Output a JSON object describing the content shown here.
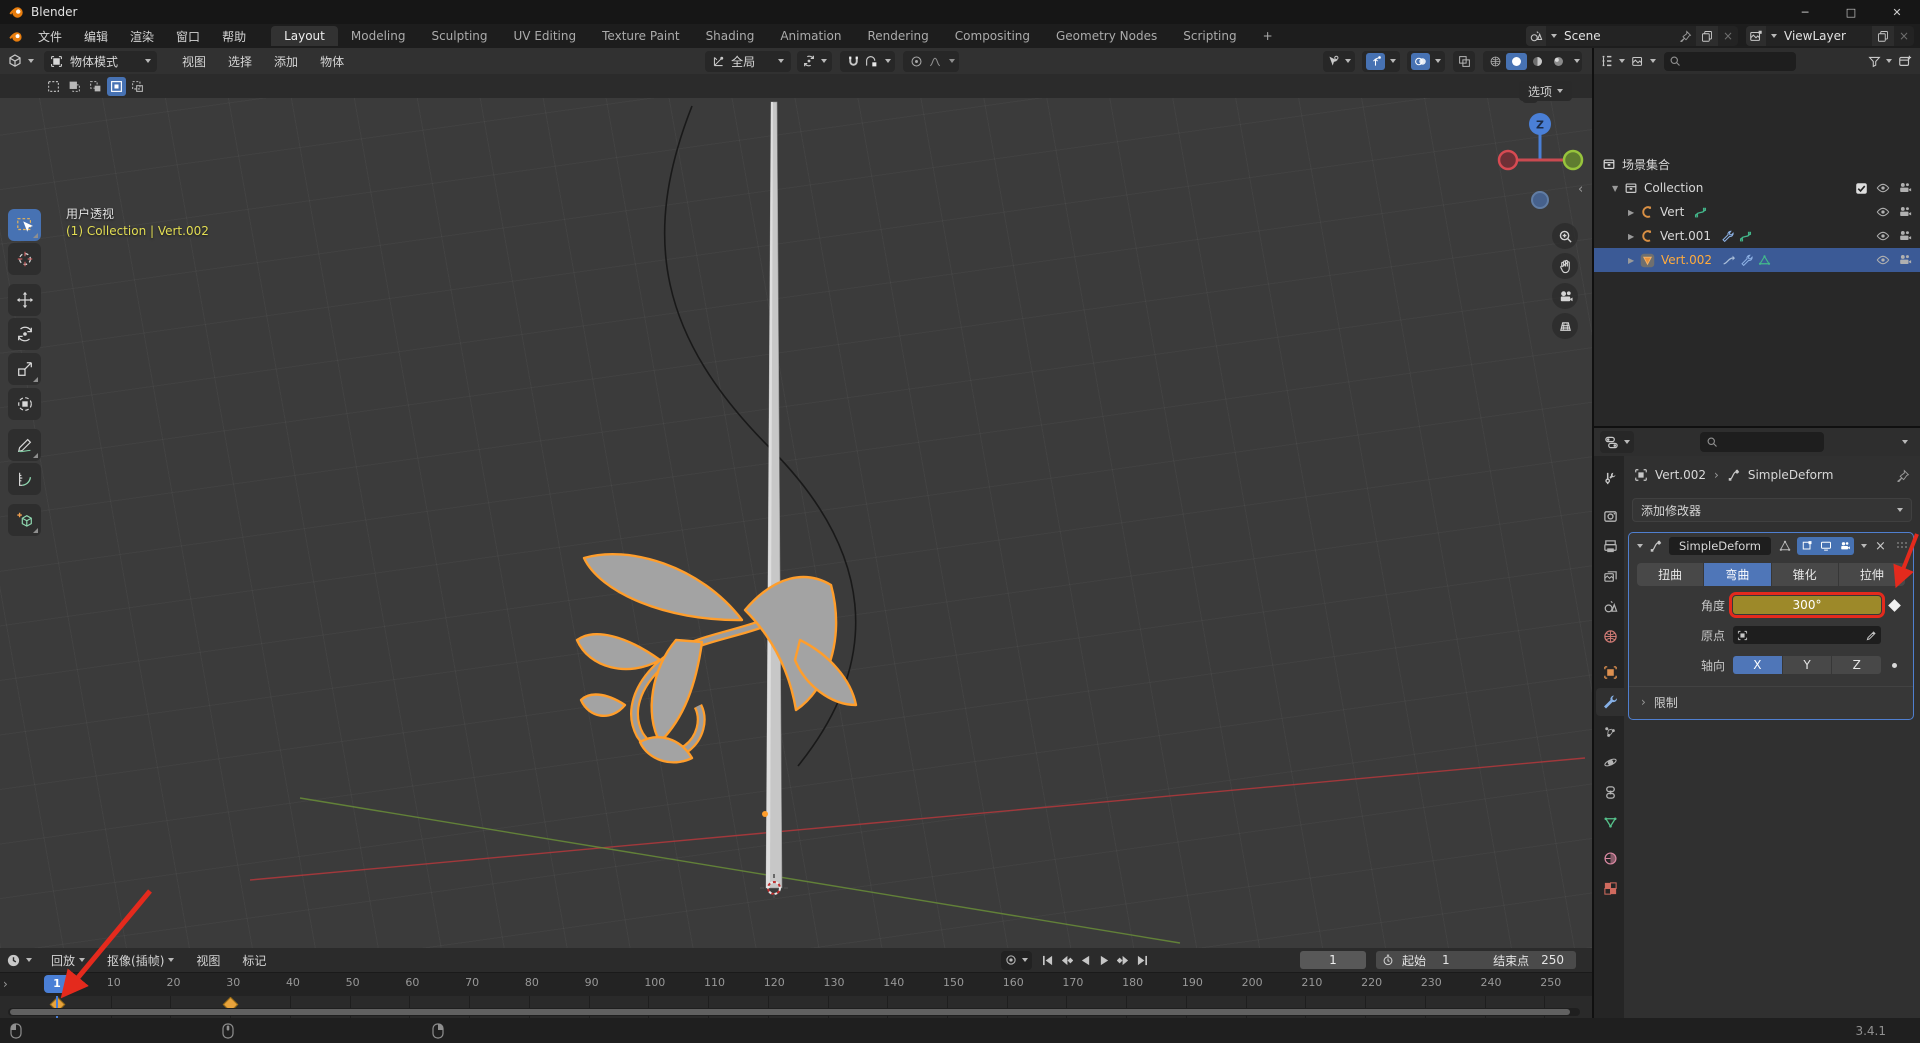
{
  "window": {
    "title": "Blender",
    "version": "3.4.1",
    "controls": {
      "minimize": "─",
      "maximize": "□",
      "close": "✕"
    }
  },
  "topbar": {
    "menus": [
      "文件",
      "编辑",
      "渲染",
      "窗口",
      "帮助"
    ],
    "tabs": [
      {
        "label": "Layout",
        "active": true
      },
      {
        "label": "Modeling",
        "active": false
      },
      {
        "label": "Sculpting",
        "active": false
      },
      {
        "label": "UV Editing",
        "active": false
      },
      {
        "label": "Texture Paint",
        "active": false
      },
      {
        "label": "Shading",
        "active": false
      },
      {
        "label": "Animation",
        "active": false
      },
      {
        "label": "Rendering",
        "active": false
      },
      {
        "label": "Compositing",
        "active": false
      },
      {
        "label": "Geometry Nodes",
        "active": false
      },
      {
        "label": "Scripting",
        "active": false
      }
    ],
    "add_tab_label": "+",
    "scene": {
      "label": "Scene"
    },
    "view_layer": {
      "label": "ViewLayer"
    }
  },
  "viewport": {
    "header": {
      "mode": "物体模式",
      "menus": [
        "视图",
        "选择",
        "添加",
        "物体"
      ],
      "orientation": "全局"
    },
    "options_label": "选项",
    "overlay": {
      "view_name": "用户透视",
      "context": "(1) Collection | Vert.002"
    },
    "gizmo_axis_label": "Z",
    "tools": [
      "box-select",
      "cursor",
      "move",
      "rotate",
      "scale",
      "transform",
      "annotate",
      "measure",
      "add-cube"
    ]
  },
  "outliner": {
    "rows": [
      {
        "label": "场景集合"
      },
      {
        "label": "Collection"
      },
      {
        "label": "Vert"
      },
      {
        "label": "Vert.001"
      },
      {
        "label": "Vert.002",
        "selected": true
      }
    ]
  },
  "properties": {
    "breadcrumb": {
      "object": "Vert.002",
      "modifier": "SimpleDeform"
    },
    "add_modifier_label": "添加修改器",
    "tabs": [
      {
        "name": "tool",
        "color": "#c6c6c6",
        "active": false
      },
      {
        "name": "render",
        "color": "#b4b4b4",
        "active": false
      },
      {
        "name": "output",
        "color": "#b4b4b4",
        "active": false
      },
      {
        "name": "view-layer",
        "color": "#b4b4b4",
        "active": false
      },
      {
        "name": "scene",
        "color": "#b4b4b4",
        "active": false
      },
      {
        "name": "world",
        "color": "#cf7a74",
        "active": false
      },
      {
        "name": "object",
        "color": "#dd9050",
        "active": false
      },
      {
        "name": "modifiers",
        "color": "#86b0e6",
        "active": true
      },
      {
        "name": "particles",
        "color": "#b4b4b4",
        "active": false
      },
      {
        "name": "physics",
        "color": "#b4b4b4",
        "active": false
      },
      {
        "name": "constraints",
        "color": "#b4b4b4",
        "active": false
      },
      {
        "name": "object-data",
        "color": "#55c08a",
        "active": false
      },
      {
        "name": "material",
        "color": "#d988a2",
        "active": false
      },
      {
        "name": "texture",
        "color": "#cf6a5e",
        "active": false
      }
    ],
    "modifier": {
      "name": "SimpleDeform",
      "tabs": [
        "扭曲",
        "弯曲",
        "锥化",
        "拉伸"
      ],
      "active_tab": "弯曲",
      "angle_label": "角度",
      "angle_value": "300°",
      "origin_label": "原点",
      "axis_label": "轴向",
      "axes": [
        "X",
        "Y",
        "Z"
      ],
      "active_axis": "X",
      "limits_label": "限制"
    }
  },
  "timeline": {
    "menus": [
      "回放",
      "抠像(插帧)",
      "视图",
      "标记"
    ],
    "current_frame": "1",
    "start_label": "起始",
    "start_value": "1",
    "end_label": "结束点",
    "end_value": "250",
    "ticks": [
      10,
      20,
      30,
      40,
      50,
      60,
      70,
      80,
      90,
      100,
      110,
      120,
      130,
      140,
      150,
      160,
      170,
      180,
      190,
      200,
      210,
      220,
      230,
      240,
      250
    ],
    "keyframes": [
      1,
      30
    ]
  },
  "colors": {
    "accent": "#4772b3",
    "active_object_orange": "#ffab3d",
    "angle_field": "#9d8929",
    "annotation_red": "#e42a1d",
    "keyframe_orange": "#e8a33c"
  }
}
